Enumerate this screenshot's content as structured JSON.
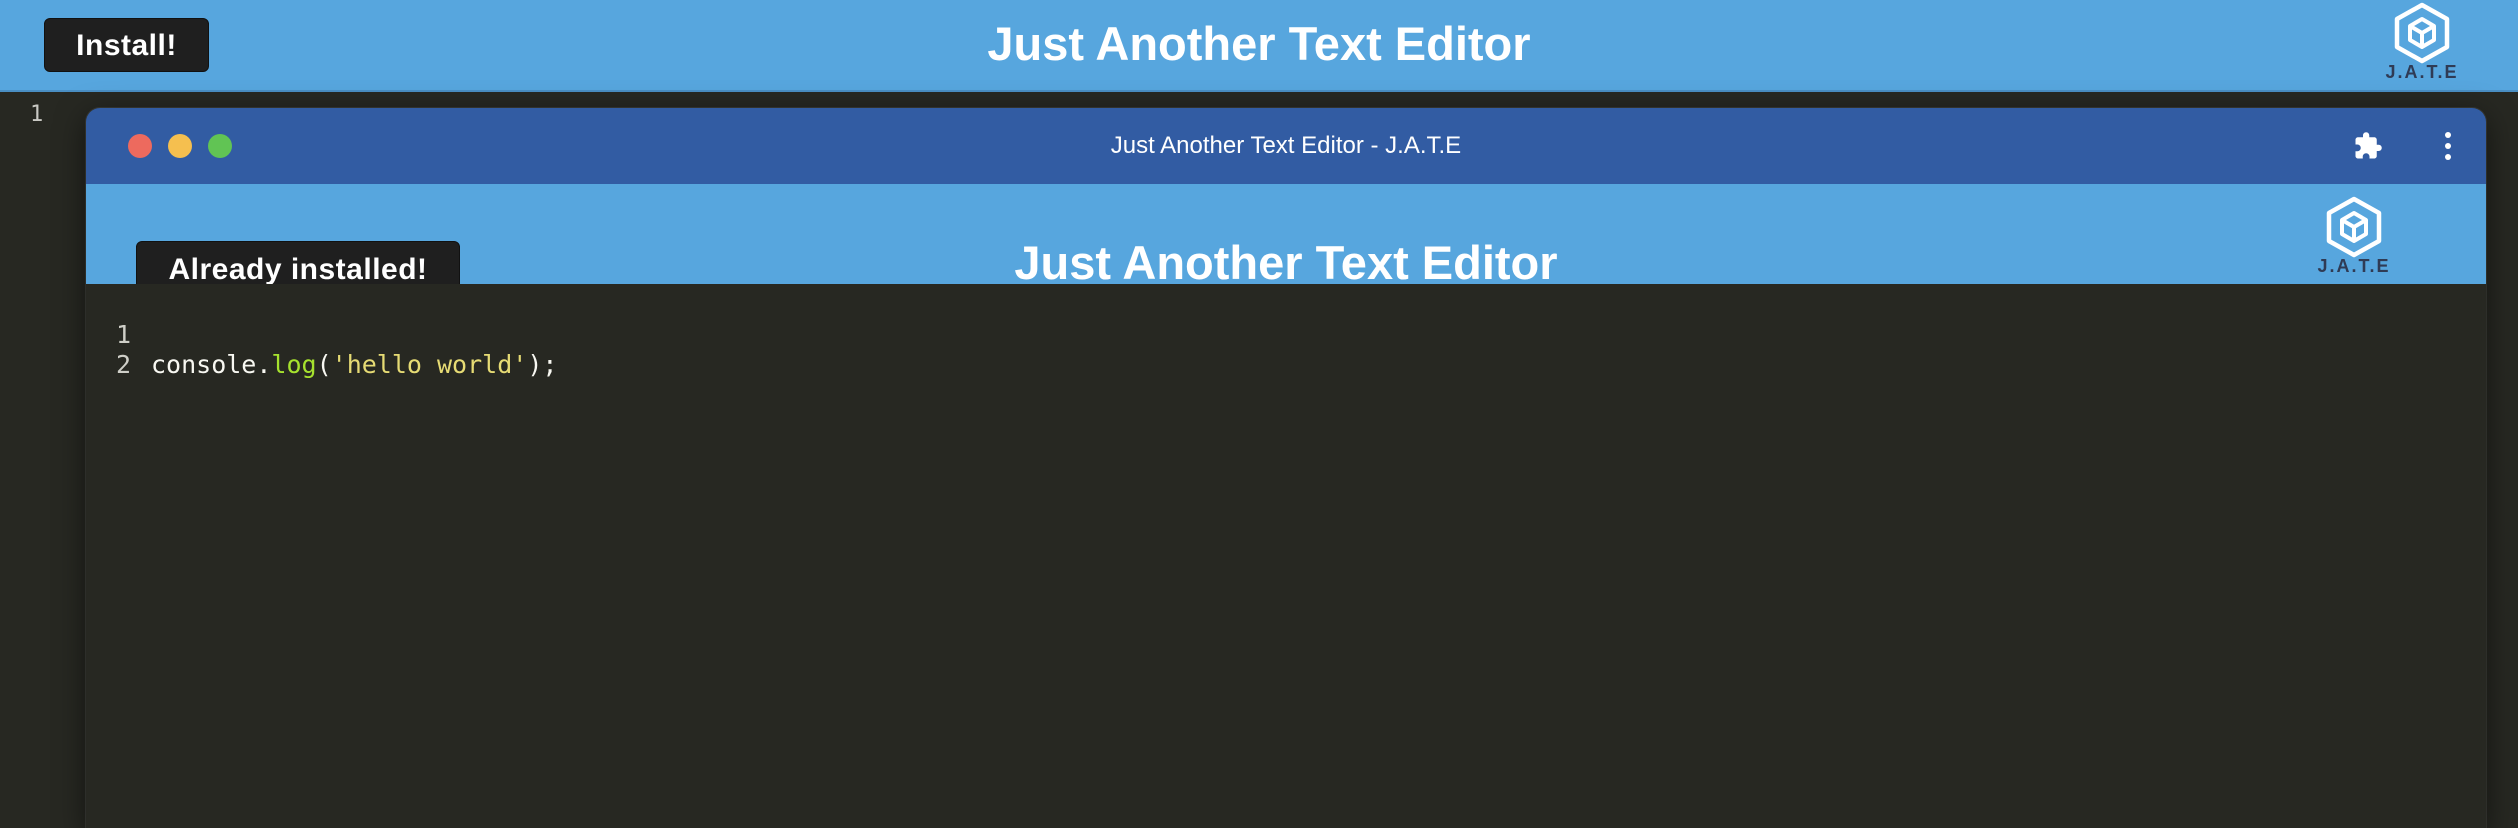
{
  "app": {
    "title": "Just Another Text Editor",
    "install_label": "Install!",
    "logo_text": "J.A.T.E",
    "logo_icon": "hexagon-cube-icon"
  },
  "outer_editor": {
    "line_numbers": [
      "1"
    ]
  },
  "window": {
    "title": "Just Another Text Editor - J.A.T.E",
    "controls": [
      "close",
      "minimize",
      "maximize"
    ],
    "toolbar_icons": [
      "puzzle-piece-icon",
      "kebab-menu-icon"
    ]
  },
  "inner_app": {
    "title": "Just Another Text Editor",
    "install_label": "Already installed!",
    "logo_text": "J.A.T.E",
    "logo_icon": "hexagon-cube-icon"
  },
  "inner_editor": {
    "lines": [
      {
        "num": "1",
        "tokens": [
          {
            "text": "console",
            "kind": "plain"
          },
          {
            "text": ".",
            "kind": "plain"
          },
          {
            "text": "log",
            "kind": "method"
          },
          {
            "text": "(",
            "kind": "plain"
          },
          {
            "text": "'hello world'",
            "kind": "string"
          },
          {
            "text": ");",
            "kind": "plain"
          }
        ]
      },
      {
        "num": "2",
        "tokens": []
      }
    ]
  },
  "colors": {
    "header_blue": "#57a6de",
    "titlebar_blue": "#325ca3",
    "editor_bg": "#272822",
    "button_bg": "#1f1f1f",
    "logo_dark": "#2f3b55",
    "syntax_method": "#a6e22e",
    "syntax_string": "#e6db74"
  }
}
